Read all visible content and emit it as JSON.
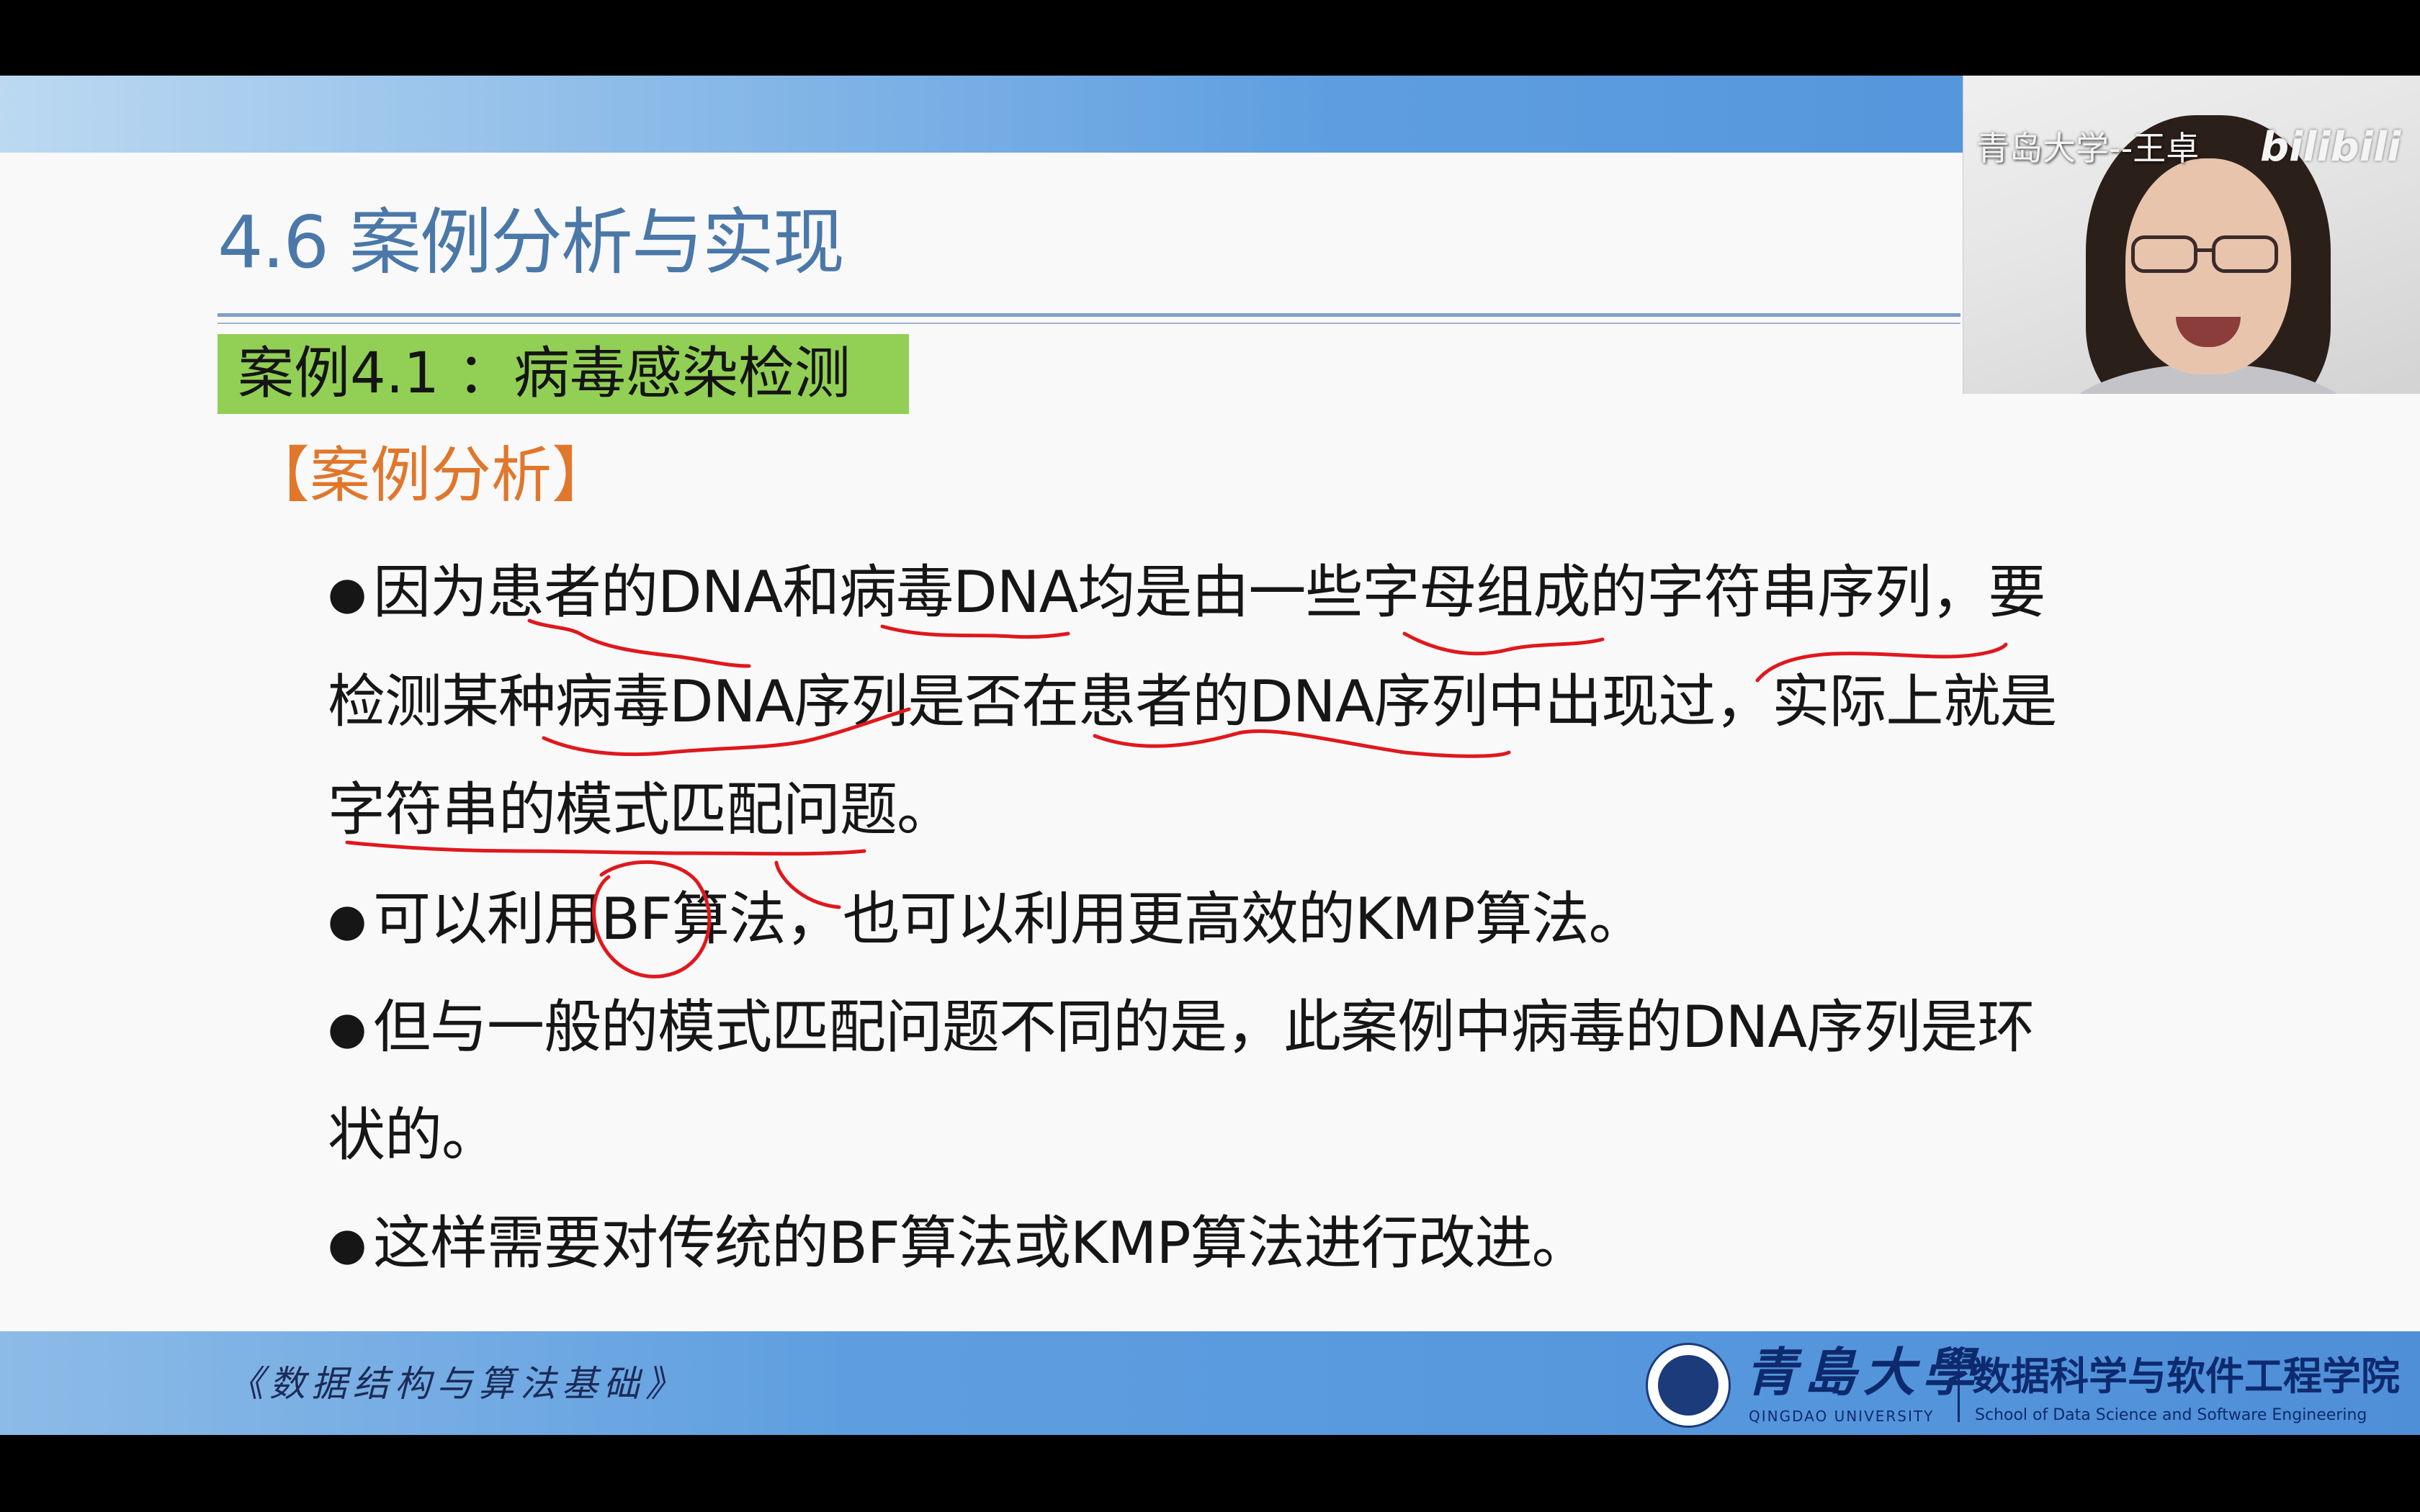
{
  "slide": {
    "title": "4.6 案例分析与实现",
    "case_title": "案例4.1 ：病毒感染检测",
    "analysis_heading": "【案例分析】",
    "bullet_symbol": "●",
    "lines": [
      "因为患者的DNA和病毒DNA均是由一些字母组成的字符串序列，要",
      "检测某种病毒DNA序列是否在患者的DNA序列中出现过，实际上就是",
      "字符串的模式匹配问题。",
      "可以利用BF算法，也可以利用更高效的KMP算法。",
      "但与一般的模式匹配问题不同的是，此案例中病毒的DNA序列是环",
      "状的。",
      "这样需要对传统的BF算法或KMP算法进行改进。"
    ]
  },
  "footer": {
    "book_title": "《数据结构与算法基础》",
    "university_cn": "青島大學",
    "university_en": "QINGDAO UNIVERSITY",
    "school_cn": "数据科学与软件工程学院",
    "school_en": "School of Data Science and Software Engineering"
  },
  "video": {
    "caption": "青岛大学--王卓",
    "watermark": "bilibili"
  },
  "colors": {
    "title": "#4a78a8",
    "case_title_bg": "#92cf55",
    "analysis": "#e0772b",
    "annotation_ink": "#e0181c",
    "band": "#5e9ee0"
  }
}
